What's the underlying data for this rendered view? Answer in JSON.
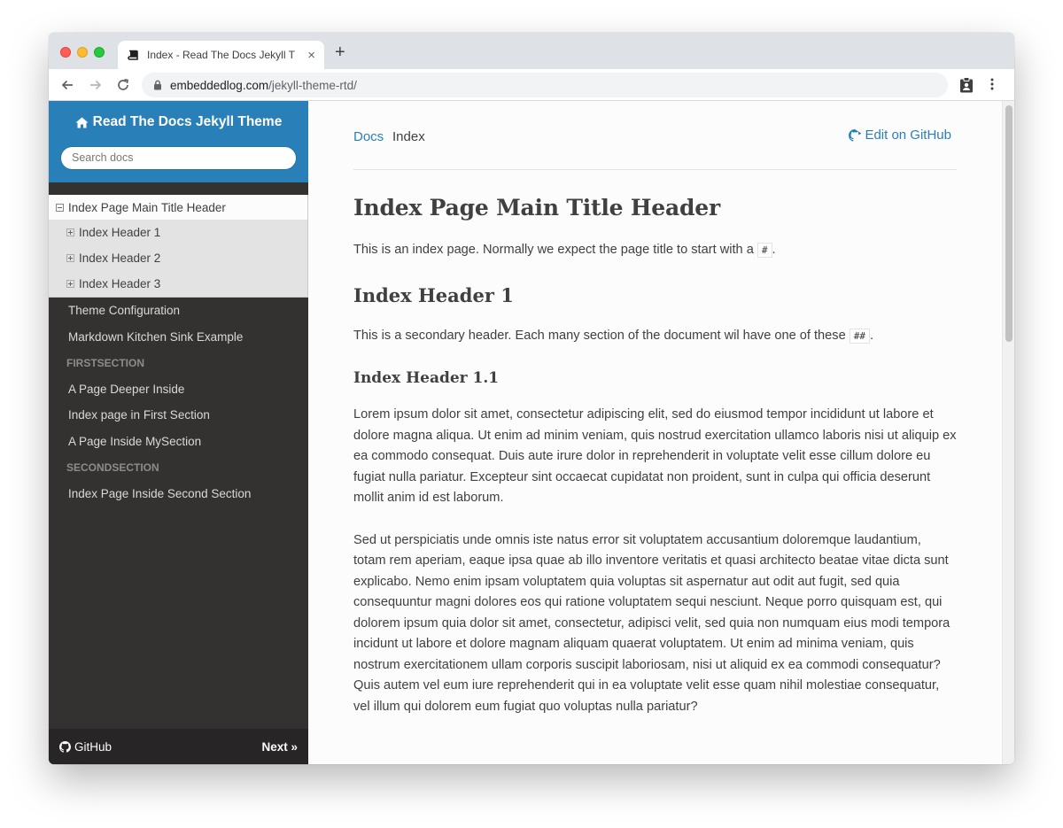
{
  "browser": {
    "tab_title": "Index - Read The Docs Jekyll T",
    "new_tab": "+",
    "close": "×",
    "url_host": "embeddedlog.com",
    "url_path": "/jekyll-theme-rtd/"
  },
  "sidebar": {
    "brand": "Read The Docs Jekyll Theme",
    "search_placeholder": "Search docs",
    "current": "Index Page Main Title Header",
    "subitems": [
      "Index Header 1",
      "Index Header 2",
      "Index Header 3"
    ],
    "items_top": [
      "Theme Configuration",
      "Markdown Kitchen Sink Example"
    ],
    "caption1": "FIRSTSECTION",
    "items_first": [
      "A Page Deeper Inside",
      "Index page in First Section",
      "A Page Inside MySection"
    ],
    "caption2": "SECONDSECTION",
    "items_second": [
      "Index Page Inside Second Section"
    ],
    "footer_github": "GitHub",
    "footer_next": "Next »"
  },
  "main": {
    "crumb_docs": "Docs",
    "crumb_current": "Index",
    "edit_link": "Edit on GitHub",
    "h1": "Index Page Main Title Header",
    "intro_before": "This is an index page. Normally we expect the page title to start with a ",
    "intro_code": "#",
    "intro_after": ".",
    "h2": "Index Header 1",
    "p2_before": "This is a secondary header. Each many section of the document wil have one of these ",
    "p2_code": "##",
    "p2_after": ".",
    "h3": "Index Header 1.1",
    "lorem1": "Lorem ipsum dolor sit amet, consectetur adipiscing elit, sed do eiusmod tempor incididunt ut labore et dolore magna aliqua. Ut enim ad minim veniam, quis nostrud exercitation ullamco laboris nisi ut aliquip ex ea commodo consequat. Duis aute irure dolor in reprehenderit in voluptate velit esse cillum dolore eu fugiat nulla pariatur. Excepteur sint occaecat cupidatat non proident, sunt in culpa qui officia deserunt mollit anim id est laborum.",
    "lorem2": "Sed ut perspiciatis unde omnis iste natus error sit voluptatem accusantium doloremque laudantium, totam rem aperiam, eaque ipsa quae ab illo inventore veritatis et quasi architecto beatae vitae dicta sunt explicabo. Nemo enim ipsam voluptatem quia voluptas sit aspernatur aut odit aut fugit, sed quia consequuntur magni dolores eos qui ratione voluptatem sequi nesciunt. Neque porro quisquam est, qui dolorem ipsum quia dolor sit amet, consectetur, adipisci velit, sed quia non numquam eius modi tempora incidunt ut labore et dolore magnam aliquam quaerat voluptatem. Ut enim ad minima veniam, quis nostrum exercitationem ullam corporis suscipit laboriosam, nisi ut aliquid ex ea commodi consequatur? Quis autem vel eum iure reprehenderit qui in ea voluptate velit esse quam nihil molestiae consequatur, vel illum qui dolorem eum fugiat quo voluptas nulla pariatur?"
  },
  "colors": {
    "brand_blue": "#2980b9",
    "sidebar_bg": "#343131",
    "text": "#404040"
  },
  "icons": {
    "favicon": "book-icon",
    "brand": "home-icon",
    "github": "github-icon",
    "lock": "lock-icon"
  }
}
